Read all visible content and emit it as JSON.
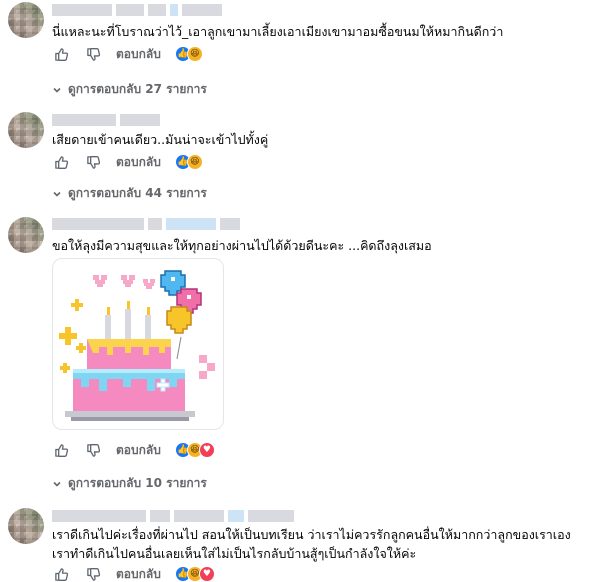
{
  "comments": [
    {
      "text": "นี่แหละนะที่โบราณว่าไว้_เอาลูกเขามาเลี้ยงเอาเมียงเขามาอมซื้อขนมให้หมากินดีกว่า",
      "reply_label": "ตอบกลับ",
      "view_replies": "ดูการตอบกลับ 27 รายการ",
      "reactions": [
        "like-icon",
        "haha-icon"
      ]
    },
    {
      "text": "เสียดายเข้าคนเดียว..มันน่าจะเข้าไปทั้งคู่",
      "reply_label": "ตอบกลับ",
      "view_replies": "ดูการตอบกลับ 44 รายการ",
      "reactions": [
        "like-icon",
        "haha-icon"
      ]
    },
    {
      "text": "ขอให้ลุงมีความสุขและให้ทุกอย่างผ่านไปได้ด้วยดีนะคะ ...คิดถึงลุงเสมอ",
      "reply_label": "ตอบกลับ",
      "view_replies": "ดูการตอบกลับ 10 รายการ",
      "reactions": [
        "like-icon",
        "haha-icon",
        "love-icon"
      ]
    },
    {
      "text_line1": "เราดีเกินไปค่ะเรื่องที่ผ่านไป สอนให้เป็นบทเรียน ว่าเราไม่ควรรักลูกคนอื่นให้มากกว่าลูกของเราเอง",
      "text_line2": "เราทำดีเกินไปคนอื่นเลยเห็นใส่ไม่เป็นไรกลับบ้านสู้ๆเป็นกำลังใจให้ค่ะ",
      "reply_label": "ตอบกลับ",
      "reactions": [
        "like-icon",
        "haha-icon",
        "love-icon"
      ]
    }
  ],
  "colors": {
    "meta_text": "#65676b",
    "like": "#1877f2",
    "haha": "#f7b125",
    "love": "#f33e58"
  }
}
